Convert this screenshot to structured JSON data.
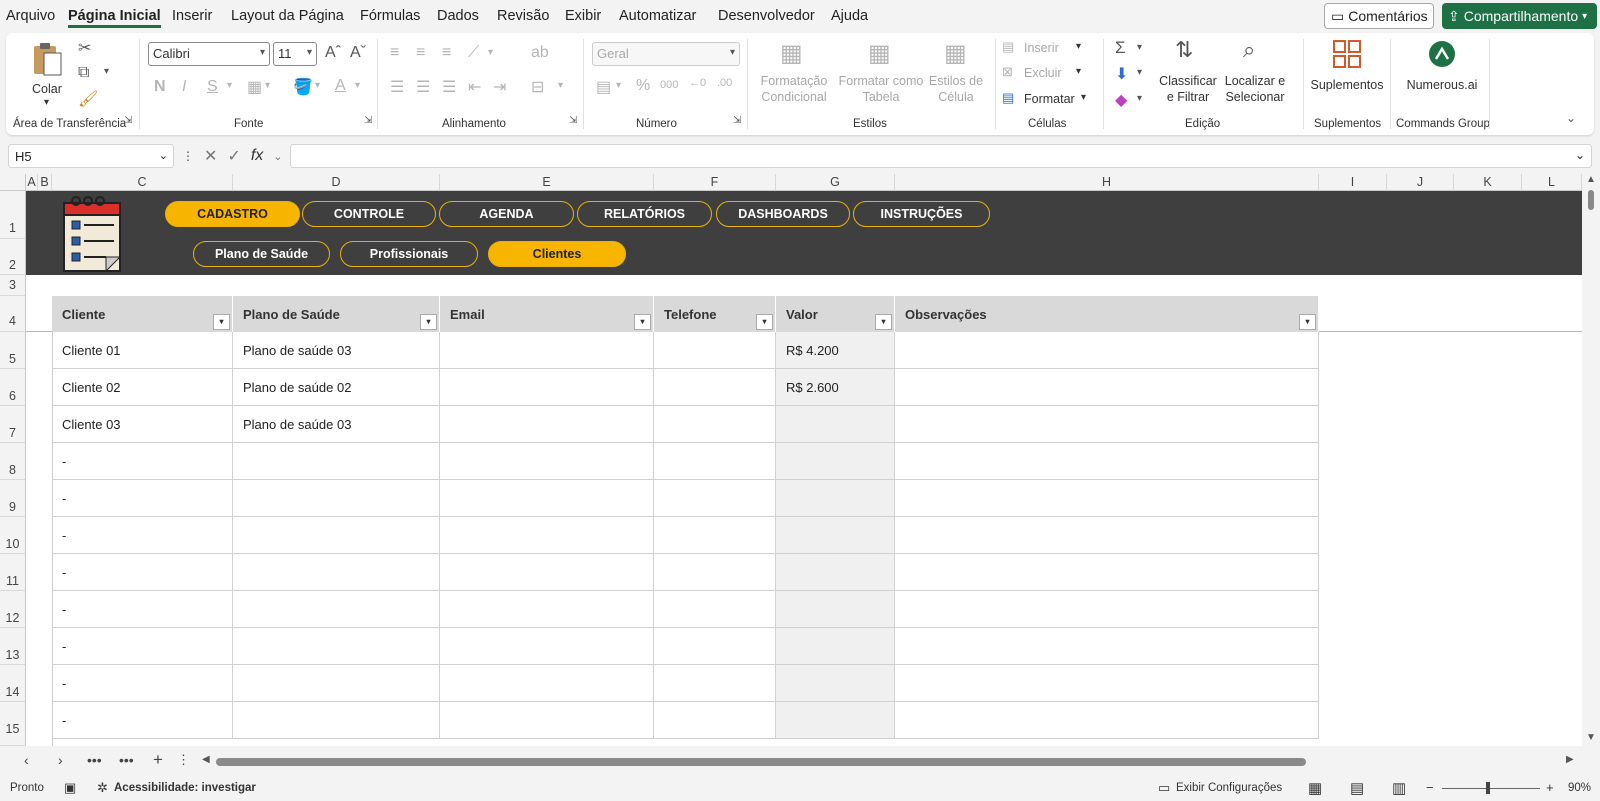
{
  "menu": {
    "items": [
      "Arquivo",
      "Página Inicial",
      "Inserir",
      "Layout da Página",
      "Fórmulas",
      "Dados",
      "Revisão",
      "Exibir",
      "Automatizar",
      "Desenvolvedor",
      "Ajuda"
    ],
    "active": "Página Inicial",
    "comments_label": "Comentários",
    "share_label": "Compartilhamento"
  },
  "ribbon": {
    "clipboard": {
      "paste_label": "Colar",
      "group_label": "Área de Transferência"
    },
    "font": {
      "family": "Calibri",
      "size": "11",
      "group_label": "Fonte",
      "bold": "N",
      "italic": "I",
      "underline": "S"
    },
    "alignment": {
      "group_label": "Alinhamento"
    },
    "number": {
      "format": "Geral",
      "group_label": "Número"
    },
    "styles": {
      "conditional_1": "Formatação",
      "conditional_2": "Condicional",
      "table_1": "Formatar como",
      "table_2": "Tabela",
      "cell_1": "Estilos de",
      "cell_2": "Célula",
      "group_label": "Estilos"
    },
    "cells": {
      "insert_label": "Inserir",
      "delete_label": "Excluir",
      "format_label": "Formatar",
      "group_label": "Células"
    },
    "editing": {
      "sort_1": "Classificar",
      "sort_2": "e Filtrar",
      "find_1": "Localizar e",
      "find_2": "Selecionar",
      "group_label": "Edição"
    },
    "addins": {
      "label": "Suplementos",
      "group_label": "Suplementos"
    },
    "commands": {
      "label": "Numerous.ai",
      "group_label": "Commands Group"
    }
  },
  "formula_bar": {
    "name_box": "H5",
    "formula": ""
  },
  "columns": [
    "A",
    "B",
    "C",
    "D",
    "E",
    "F",
    "G",
    "H",
    "I",
    "J",
    "K",
    "L"
  ],
  "rows": [
    "1",
    "2",
    "3",
    "4",
    "5",
    "6",
    "7",
    "8",
    "9",
    "10",
    "11",
    "12",
    "13",
    "14",
    "15"
  ],
  "nav": {
    "main": [
      "CADASTRO",
      "CONTROLE",
      "AGENDA",
      "RELATÓRIOS",
      "DASHBOARDS",
      "INSTRUÇÕES"
    ],
    "main_active": "CADASTRO",
    "sub": [
      "Plano de Saúde",
      "Profissionais",
      "Clientes"
    ],
    "sub_active": "Clientes"
  },
  "table": {
    "headers": [
      "Cliente",
      "Plano de Saúde",
      "Email",
      "Telefone",
      "Valor",
      "Observações"
    ],
    "rows": [
      [
        "Cliente 01",
        "Plano de saúde 03",
        "",
        "",
        "R$ 4.200",
        ""
      ],
      [
        "Cliente 02",
        "Plano de saúde 02",
        "",
        "",
        "R$ 2.600",
        ""
      ],
      [
        "Cliente 03",
        "Plano de saúde 03",
        "",
        "",
        "",
        ""
      ],
      [
        "-",
        "",
        "",
        "",
        "",
        ""
      ],
      [
        "-",
        "",
        "",
        "",
        "",
        ""
      ],
      [
        "-",
        "",
        "",
        "",
        "",
        ""
      ],
      [
        "-",
        "",
        "",
        "",
        "",
        ""
      ],
      [
        "-",
        "",
        "",
        "",
        "",
        ""
      ],
      [
        "-",
        "",
        "",
        "",
        "",
        ""
      ],
      [
        "-",
        "",
        "",
        "",
        "",
        ""
      ],
      [
        "-",
        "",
        "",
        "",
        "",
        ""
      ]
    ]
  },
  "status": {
    "ready": "Pronto",
    "accessibility": "Acessibilidade: investigar",
    "display_settings": "Exibir Configurações",
    "zoom": "90%"
  },
  "colors": {
    "accent": "#1e7145",
    "nav_active": "#f8b500",
    "banner": "#3f3f3f",
    "header_fill": "#d9d9d9"
  }
}
